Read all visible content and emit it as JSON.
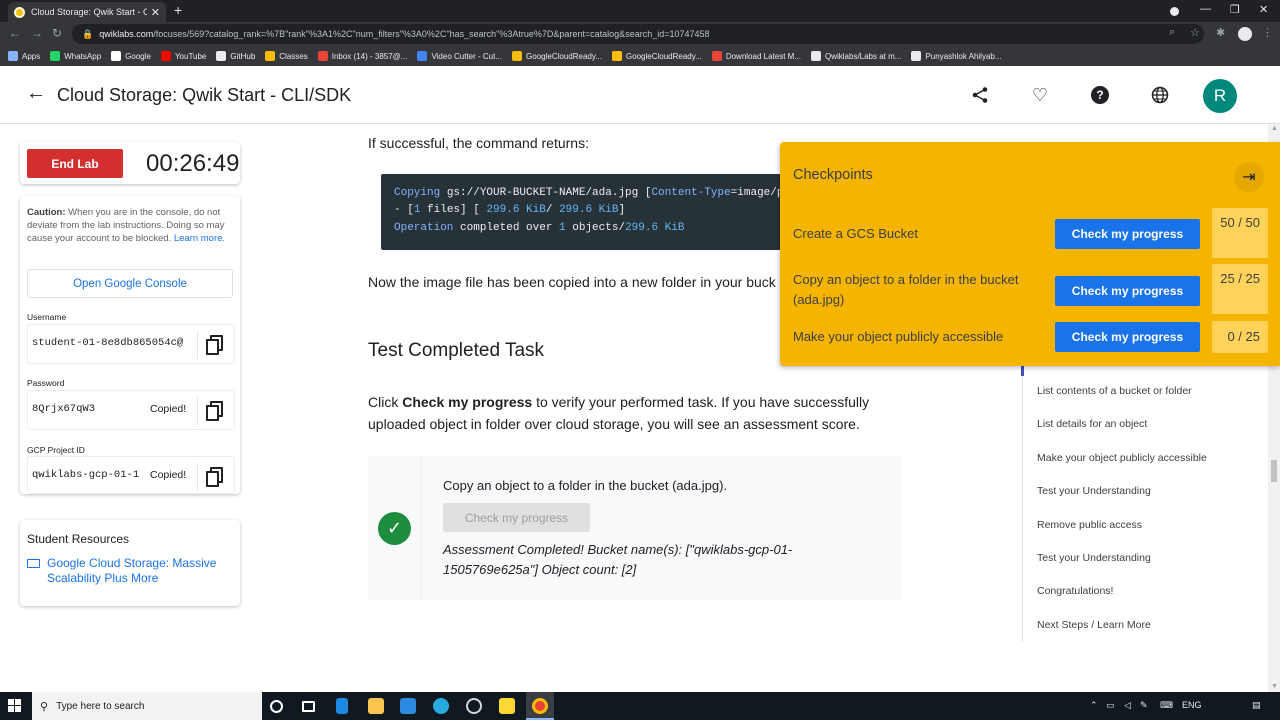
{
  "browser": {
    "tab_title": "Cloud Storage: Qwik Start - CLI/S",
    "tab_close": "✕",
    "new_tab": "+",
    "url_host": "qwiklabs.com",
    "url_path": "/focuses/569?catalog_rank=%7B\"rank\"%3A1%2C\"num_filters\"%3A0%2C\"has_search\"%3Atrue%7D&parent=catalog&search_id=10747458",
    "bookmarks": [
      {
        "label": "Apps",
        "color": "#8ab4f8"
      },
      {
        "label": "WhatsApp",
        "color": "#25d366"
      },
      {
        "label": "Google",
        "color": "#ffffff"
      },
      {
        "label": "YouTube",
        "color": "#ff0000"
      },
      {
        "label": "GitHub",
        "color": "#e8eaed"
      },
      {
        "label": "Classes",
        "color": "#fbbc04"
      },
      {
        "label": "Inbox (14) - 3857@...",
        "color": "#ea4335"
      },
      {
        "label": "Video Cutter - Cut...",
        "color": "#4285f4"
      },
      {
        "label": "GoogleCloudReady...",
        "color": "#fbbc04"
      },
      {
        "label": "GoogleCloudReady...",
        "color": "#fbbc04"
      },
      {
        "label": "Download Latest M...",
        "color": "#ea4335"
      },
      {
        "label": "Qwiklabs/Labs at m...",
        "color": "#e8eaed"
      },
      {
        "label": "Punyashlok Ahilyab...",
        "color": "#e8eaed"
      }
    ]
  },
  "header": {
    "title": "Cloud Storage: Qwik Start - CLI/SDK",
    "user_initial": "R",
    "accent": "#00897b"
  },
  "lab": {
    "end_label": "End Lab",
    "timer": "00:26:49",
    "caution_label": "Caution:",
    "caution_text": " When you are in the console, do not deviate from the lab instructions. Doing so may cause your account to be blocked. ",
    "learn_more": "Learn more.",
    "console_button": "Open Google Console",
    "username_label": "Username",
    "username_value": "student-01-8e8db865054c@",
    "password_label": "Password",
    "password_value": "8Qrjx67qW3",
    "password_status": "Copied!",
    "project_label": "GCP Project ID",
    "project_value": "qwiklabs-gcp-01-1",
    "project_status": "Copied!",
    "resources_title": "Student Resources",
    "resource_link": "Google Cloud Storage: Massive Scalability Plus More"
  },
  "content": {
    "intro": "If successful, the command returns:",
    "code_l1_a": "Copying",
    "code_l1_b": " gs://YOUR-BUCKET-NAME/ada.jpg [",
    "code_l1_c": "Content-Type",
    "code_l1_d": "=image/p",
    "code_l2_a": "- [",
    "code_l2_b": "1",
    "code_l2_c": " files] [ ",
    "code_l2_d": "299.6 KiB",
    "code_l2_e": "/ ",
    "code_l2_f": "299.6 KiB",
    "code_l2_g": "]",
    "code_l3_a": "Operation",
    "code_l3_b": " completed over ",
    "code_l3_c": "1",
    "code_l3_d": " objects/",
    "code_l3_e": "299.6 KiB",
    "after_code": "Now the image file has been copied into a new folder in your buck",
    "section_title": "Test Completed Task",
    "para_a": "Click ",
    "para_bold": "Check my progress",
    "para_b": " to verify your performed task. If you have successfully uploaded object in folder over cloud storage, you will see an assessment score.",
    "task_title": "Copy an object to a folder in the bucket (ada.jpg).",
    "task_button": "Check my progress",
    "task_result": "Assessment Completed! Bucket name(s): [\"qwiklabs-gcp-01-1505769e625a\"] Object count: [2]"
  },
  "toc": [
    "List contents of a bucket or folder",
    "List details for an object",
    "Make your object publicly accessible",
    "Test your Understanding",
    "Remove public access",
    "Test your Understanding",
    "Congratulations!",
    "Next Steps / Learn More"
  ],
  "checkpoints": {
    "title": "Checkpoints",
    "color": "#f4b400",
    "items": [
      {
        "label": "Create a GCS Bucket",
        "button": "Check my progress",
        "score": "50 / 50"
      },
      {
        "label": "Copy an object to a folder in the bucket (ada.jpg)",
        "button": "Check my progress",
        "score": "25 / 25"
      },
      {
        "label": "Make your object publicly accessible",
        "button": "Check my progress",
        "score": "0 / 25"
      }
    ]
  },
  "taskbar": {
    "search_placeholder": "Type here to search",
    "lang": "ENG"
  }
}
